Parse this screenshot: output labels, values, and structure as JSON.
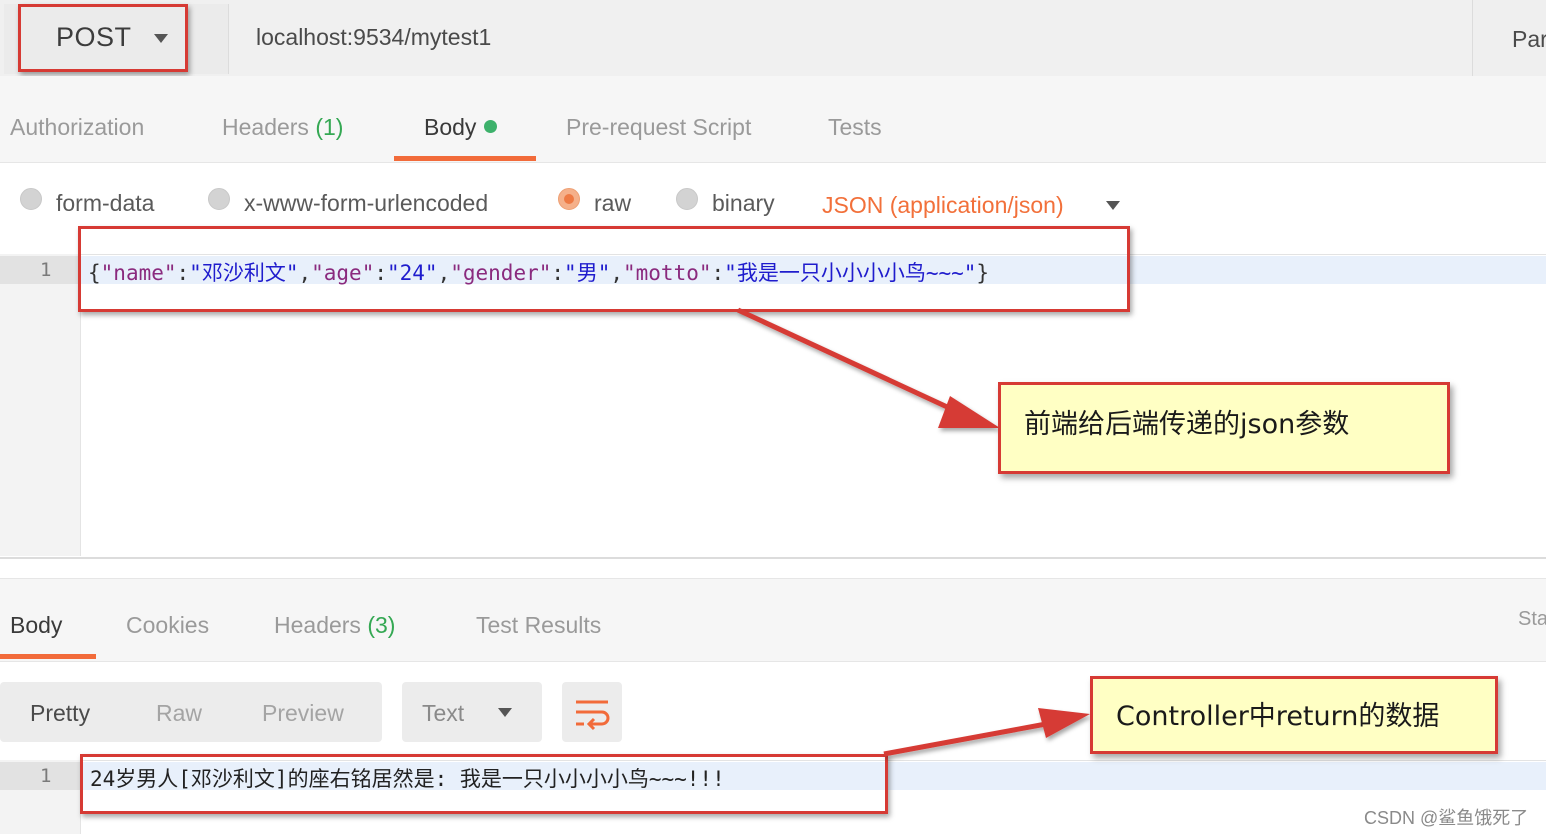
{
  "request": {
    "method": "POST",
    "url": "localhost:9534/mytest1",
    "params_label": "Par"
  },
  "request_tabs": [
    {
      "label": "Authorization",
      "count": ""
    },
    {
      "label": "Headers",
      "count": "(1)"
    },
    {
      "label": "Body",
      "count": "",
      "active": true,
      "indicator": "green-dot"
    },
    {
      "label": "Pre-request Script",
      "count": ""
    },
    {
      "label": "Tests",
      "count": ""
    }
  ],
  "body_types": {
    "options": [
      "form-data",
      "x-www-form-urlencoded",
      "raw",
      "binary"
    ],
    "selected": "raw",
    "content_type": "JSON (application/json)"
  },
  "request_editor": {
    "line_number": "1",
    "code": "{\"name\":\"邓沙利文\",\"age\":\"24\",\"gender\":\"男\",\"motto\":\"我是一只小小小小鸟~~~\"}"
  },
  "response_tabs": [
    {
      "label": "Body",
      "count": "",
      "active": true
    },
    {
      "label": "Cookies",
      "count": ""
    },
    {
      "label": "Headers",
      "count": "(3)"
    },
    {
      "label": "Test Results",
      "count": ""
    }
  ],
  "status_label": "Sta",
  "response_toolbar": {
    "views": [
      "Pretty",
      "Raw",
      "Preview"
    ],
    "selected_view": "Pretty",
    "format": "Text"
  },
  "response_editor": {
    "line_number": "1",
    "text": "24岁男人[邓沙利文]的座右铭居然是: 我是一只小小小小鸟~~~!!!"
  },
  "annotations": {
    "request_callout": "前端给后端传递的json参数",
    "response_callout": "Controller中return的数据"
  },
  "watermark": "CSDN @鲨鱼饿死了",
  "colors": {
    "accent": "#f26b3a",
    "count_green": "#34a853",
    "highlight_red": "#d63a34",
    "callout_bg": "#ffffc4",
    "json_key": "#8a2a7e",
    "json_string": "#1f1ccd"
  }
}
